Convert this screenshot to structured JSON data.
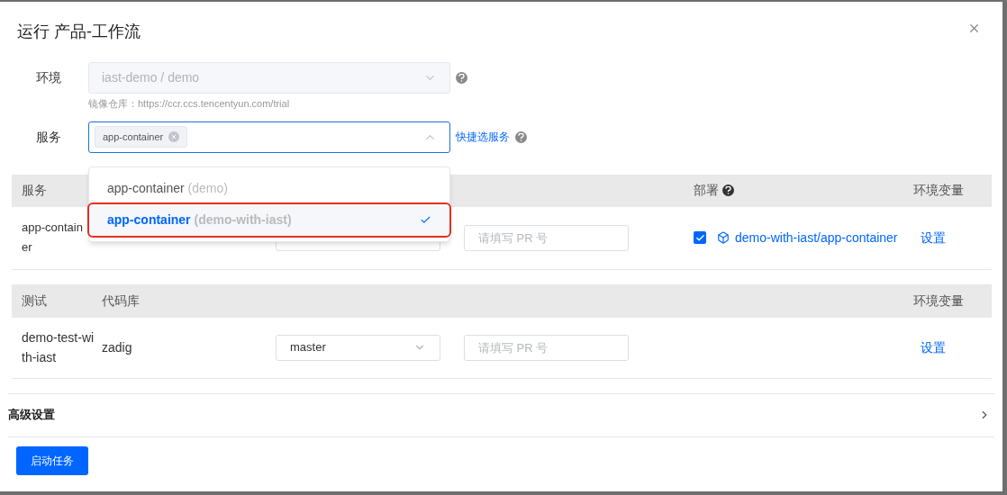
{
  "dialog": {
    "title": "运行 产品-工作流"
  },
  "environment": {
    "label": "环境",
    "value": "iast-demo / demo",
    "disabled": true,
    "hint": "镜像仓库：https://ccr.ccs.tencentyun.com/trial"
  },
  "service": {
    "label": "服务",
    "tags": [
      "app-container"
    ],
    "expanded": true,
    "quick_link": "快捷选服务"
  },
  "dropdown": {
    "options": [
      {
        "name": "app-container",
        "env": "(demo)",
        "selected": false,
        "highlighted": false
      },
      {
        "name": "app-container",
        "env": "(demo-with-iast)",
        "selected": true,
        "highlighted": true
      }
    ]
  },
  "service_table": {
    "headers": {
      "service": "服务",
      "deploy": "部署",
      "env_vars": "环境变量"
    },
    "rows": [
      {
        "name": "app-container",
        "pr_placeholder": "请填写 PR 号",
        "deploy_checked": true,
        "deploy_target": "demo-with-iast/app-container",
        "env_vars": "设置"
      }
    ]
  },
  "test_table": {
    "headers": {
      "test": "测试",
      "repo": "代码库",
      "env_vars": "环境变量"
    },
    "rows": [
      {
        "name": "demo-test-with-iast",
        "repo": "zadig",
        "branch": "master",
        "pr_placeholder": "请填写 PR 号",
        "env_vars": "设置"
      }
    ]
  },
  "advanced": {
    "label": "高级设置",
    "expanded": false
  },
  "start_button": "启动任务"
}
